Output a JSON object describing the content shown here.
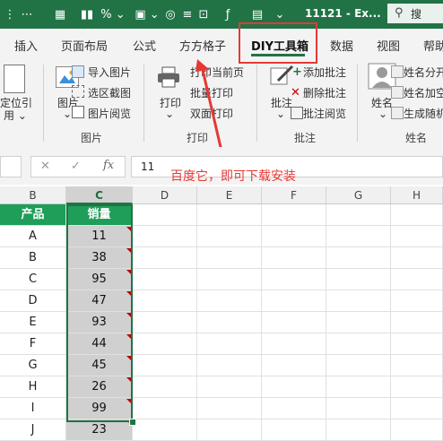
{
  "window": {
    "doc_title": "11121 - Ex...",
    "search_label": "搜"
  },
  "tabs": [
    "插入",
    "页面布局",
    "公式",
    "方方格子",
    "DIY工具箱",
    "数据",
    "视图",
    "帮助"
  ],
  "active_tab": "DIY工具箱",
  "ribbon": {
    "left_cut": {
      "line1": "定位引",
      "line2": "用 ⌄"
    },
    "picture_group": {
      "label": "图片",
      "big_button": "图片",
      "items": [
        "导入图片",
        "选区截图",
        "图片阅览"
      ]
    },
    "print_group": {
      "label": "打印",
      "big_button": "打印",
      "items": [
        "打印当前页",
        "批量打印",
        "双面打印"
      ]
    },
    "comment_group": {
      "label": "批注",
      "big_button": "批注",
      "items": [
        "添加批注",
        "删除批注",
        "批注阅览"
      ]
    },
    "name_group": {
      "label": "姓名",
      "big_button": "姓名",
      "items": [
        "姓名分开",
        "姓名加空",
        "生成随机"
      ]
    }
  },
  "formula_bar": {
    "value": "11"
  },
  "annotation": "百度它，即可下载安装",
  "columns": [
    "B",
    "C",
    "D",
    "E",
    "F",
    "G",
    "H"
  ],
  "table": {
    "headers": [
      "产品",
      "销量"
    ],
    "rows": [
      [
        "A",
        "11"
      ],
      [
        "B",
        "38"
      ],
      [
        "C",
        "95"
      ],
      [
        "D",
        "47"
      ],
      [
        "E",
        "93"
      ],
      [
        "F",
        "44"
      ],
      [
        "G",
        "45"
      ],
      [
        "H",
        "26"
      ],
      [
        "I",
        "99"
      ],
      [
        "J",
        "23"
      ]
    ]
  },
  "colors": {
    "excel_green": "#217346",
    "header_fill": "#1e9e58",
    "highlight_red": "#e53935",
    "selected_fill": "#d0d0d0"
  }
}
